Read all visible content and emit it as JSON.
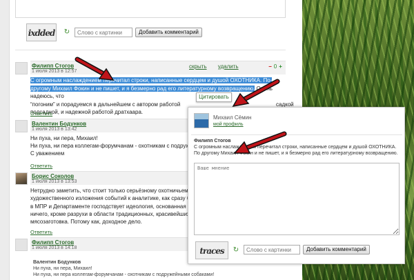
{
  "top_form": {
    "captcha_text": "ixdded",
    "captcha_placeholder": "Слово с картинки",
    "submit_label": "Добавить комментарий"
  },
  "comments": [
    {
      "author": "Филипп Стогов",
      "date": "1 июля 2013 в 12:57",
      "hide_label": "скрыть",
      "delete_label": "удалить",
      "vote_minus": "−",
      "vote_count": "0",
      "vote_plus": "+",
      "text_selected": "С огромным наслаждением перечитал строки, написанные сердцем и душой ОХОТНИКА. По-другому Михаил Фокин и не пишет, и я безмерно рад его литературному возвращению.",
      "text_rest_1": "Очень надеюсь, что ",
      "text_rest_2": "“погоним” и порадуемся в дальнейшем с автором работой ",
      "text_rest_3": "садкой",
      "text_rest_4": "подсадной, и надежной работой дратхаара.",
      "reply_label": "Ответить"
    },
    {
      "author": "Валентин Бодунков",
      "date": "1 июля 2013 в 13:42",
      "line1": "Ни пуха, ни пера, Михаил!",
      "line2": "Ни пуха, ни пера коллегам-форумчанам - охотникам с подружейными",
      "line3": "С уважением",
      "reply_label": "Ответить"
    },
    {
      "author": "Борис Соколов",
      "date": "1 июля 2013 в 13:53",
      "line1": "Нетрудно заметить, что стоит только серьёзному охотничьему автору",
      "line2": "художественного изложения событий к аналитике, как сразу бескомп",
      "line3": "в МПР и Департаменте господствует идеология, основанная на комм",
      "line4": "ничего, кроме разрухи в области традиционных, красивейших охот на",
      "line5": "мясозаготовка. Потому как, доходное дело.",
      "reply_label": "Ответить"
    },
    {
      "author": "Филипп Стогов",
      "date": "1 июля 2013 в 14:18",
      "quote_author": "Валентин Бодунков",
      "quote_line1": "Ни пуха, ни пера, Михаил!",
      "quote_line2": "Ни пуха, ни пера коллегам-форумчанам - охотникам с подружейными собаками!"
    }
  ],
  "cite_button": "Цитировать",
  "popup": {
    "user_name": "Михаил Сёмин",
    "profile_link": "мой профиль",
    "quote_author": "Филипп Стогов",
    "quote_text": "С огромным наслаждением перечитал строки, написанные сердцем и душой ОХОТНИКА. По другому Михаил Фокин и не пишет, и я безмерно рад его литературному возвращению.",
    "textarea_placeholder": "Ваше мнение",
    "captcha_text": "traces",
    "captcha_placeholder": "Слово с картинки",
    "submit_label": "Добавить комментарий"
  },
  "colors": {
    "link_green": "#2a6a2a",
    "selection_blue": "#3c8bd6",
    "arrow_red": "#c0141a"
  }
}
